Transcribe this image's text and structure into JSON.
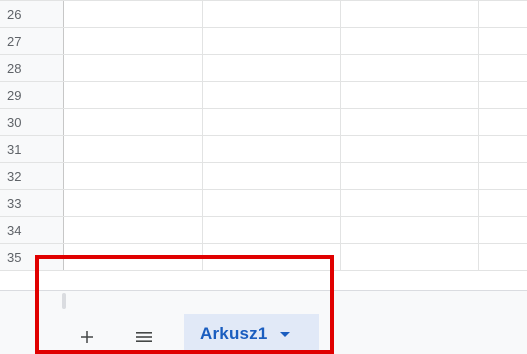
{
  "grid": {
    "rows": [
      {
        "number": "26"
      },
      {
        "number": "27"
      },
      {
        "number": "28"
      },
      {
        "number": "29"
      },
      {
        "number": "30"
      },
      {
        "number": "31"
      },
      {
        "number": "32"
      },
      {
        "number": "33"
      },
      {
        "number": "34"
      },
      {
        "number": "35"
      }
    ]
  },
  "sheet_bar": {
    "add_sheet_icon": "plus-icon",
    "all_sheets_icon": "menu-icon",
    "active_tab": {
      "label": "Arkusz1",
      "dropdown_icon": "caret-down-icon"
    }
  },
  "annotation": {
    "highlight_color": "#e00000"
  },
  "colors": {
    "tab_active_bg": "#e1e9f7",
    "tab_active_text": "#1a5dbf"
  }
}
